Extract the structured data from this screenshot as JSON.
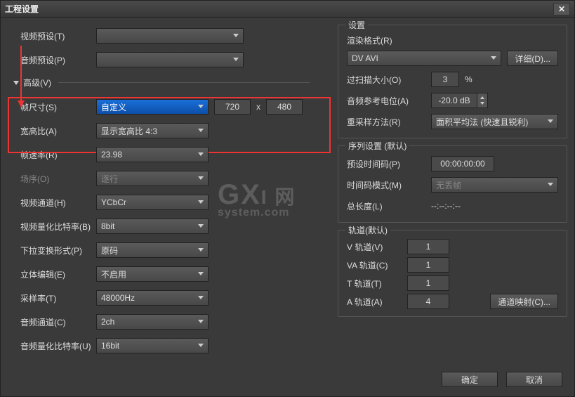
{
  "title": "工程设置",
  "left": {
    "video_preset_label": "视频预设(T)",
    "audio_preset_label": "音频预设(P)",
    "advanced_label": "高级(V)",
    "frame_size_label": "帧尺寸(S)",
    "frame_size_mode": "自定义",
    "frame_w": "720",
    "frame_h": "480",
    "aspect_label": "宽高比(A)",
    "aspect_value": "显示宽高比 4:3",
    "fps_label": "帧速率(R)",
    "fps_value": "23.98",
    "field_label": "场序(O)",
    "field_value": "逐行",
    "vchan_label": "视频通道(H)",
    "vchan_value": "YCbCr",
    "vbit_label": "视频量化比特率(B)",
    "vbit_value": "8bit",
    "pulldown_label": "下拉变换形式(P)",
    "pulldown_value": "原码",
    "stereo_edit_label": "立体编辑(E)",
    "stereo_edit_value": "不启用",
    "srate_label": "采样率(T)",
    "srate_value": "48000Hz",
    "achan_label": "音频通道(C)",
    "achan_value": "2ch",
    "abit_label": "音频量化比特率(U)",
    "abit_value": "16bit"
  },
  "settings": {
    "title": "设置",
    "render_fmt_label": "渲染格式(R)",
    "render_fmt_value": "DV AVI",
    "detail_btn": "详细(D)...",
    "overscan_label": "过扫描大小(O)",
    "overscan_value": "3",
    "overscan_unit": "%",
    "audio_ref_label": "音频参考电位(A)",
    "audio_ref_value": "-20.0 dB",
    "resample_label": "重采样方法(R)",
    "resample_value": "面积平均法 (快速且锐利)"
  },
  "seq": {
    "title": "序列设置 (默认)",
    "tc_label": "预设时间码(P)",
    "tc_value": "00:00:00:00",
    "tc_mode_label": "时间码模式(M)",
    "tc_mode_value": "无丢帧",
    "total_label": "总长度(L)",
    "total_value": "--:--:--:--"
  },
  "tracks": {
    "title": "轨道(默认)",
    "v_label": "V 轨道(V)",
    "v_val": "1",
    "va_label": "VA 轨道(C)",
    "va_val": "1",
    "t_label": "T 轨道(T)",
    "t_val": "1",
    "a_label": "A 轨道(A)",
    "a_val": "4",
    "chmap_btn": "通道映射(C)..."
  },
  "footer": {
    "ok": "确定",
    "cancel": "取消"
  },
  "watermark": {
    "big": "GX",
    "sub": "system.com"
  }
}
